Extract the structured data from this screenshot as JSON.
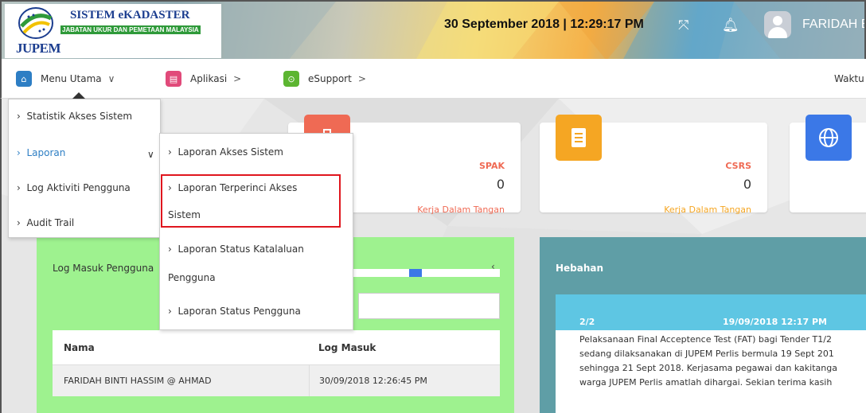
{
  "header": {
    "app_title": "SISTEM eKADASTER",
    "app_subtitle": "JABATAN UKUR DAN PEMETAAN MALAYSIA",
    "logo_abbr": "JUPEM",
    "datetime": "30 September 2018 | 12:29:17 PM",
    "username": "FARIDAH B",
    "icons": [
      "fullscreen-icon",
      "bell-icon",
      "user-avatar"
    ]
  },
  "nav": {
    "items": [
      {
        "label": "Menu Utama",
        "icon": "home-icon",
        "color": "#2d7ec4",
        "caret": "∨"
      },
      {
        "label": "Aplikasi",
        "icon": "app-icon",
        "color": "#e14a7a",
        "caret": ">"
      },
      {
        "label": "eSupport",
        "icon": "support-icon",
        "color": "#5cb531",
        "caret": ">"
      }
    ],
    "right_label": "Waktu"
  },
  "menu_utama": {
    "items": [
      {
        "label": "Statistik Akses Sistem"
      },
      {
        "label": "Laporan",
        "active": true
      },
      {
        "label": "Log Aktiviti Pengguna"
      },
      {
        "label": "Audit Trail"
      }
    ]
  },
  "laporan_submenu": {
    "items": [
      {
        "line1": "Laporan Akses Sistem"
      },
      {
        "line1": "Laporan Terperinci Akses",
        "line2": "Sistem"
      },
      {
        "line1": "Laporan Status Katalaluan",
        "line2": "Pengguna"
      },
      {
        "line1": "Laporan Status Pengguna"
      }
    ]
  },
  "cards": [
    {
      "title": "SPAK",
      "count": "0",
      "subtitle": "Kerja Dalam Tangan",
      "icon": "briefcase-icon",
      "color": "#ef6a54"
    },
    {
      "title": "CSRS",
      "count": "0",
      "subtitle": "Kerja Dalam Tangan",
      "icon": "document-icon",
      "color": "#f5a623"
    },
    {
      "title": "",
      "count": "",
      "subtitle": "",
      "icon": "globe-icon",
      "color": "#3b78e7"
    }
  ],
  "log_masuk": {
    "title": "Log Masuk Pengguna",
    "columns": [
      "Nama",
      "Log Masuk"
    ],
    "rows": [
      {
        "nama": "FARIDAH BINTI HASSIM @ AHMAD",
        "log_masuk": "30/09/2018 12:26:45 PM"
      }
    ]
  },
  "hebahan": {
    "title": "Hebahan",
    "counter": "2/2",
    "date": "19/09/2018 12:17 PM",
    "text_lines": [
      "Pelaksanaan Final Acceptence Test (FAT) bagi Tender T1/2",
      "sedang dilaksanakan di JUPEM Perlis bermula 19 Sept 201",
      "sehingga 21 Sept 2018. Kerjasama pegawai dan kakitanga",
      "warga JUPEM Perlis amatlah dihargai. Sekian terima kasih"
    ]
  }
}
